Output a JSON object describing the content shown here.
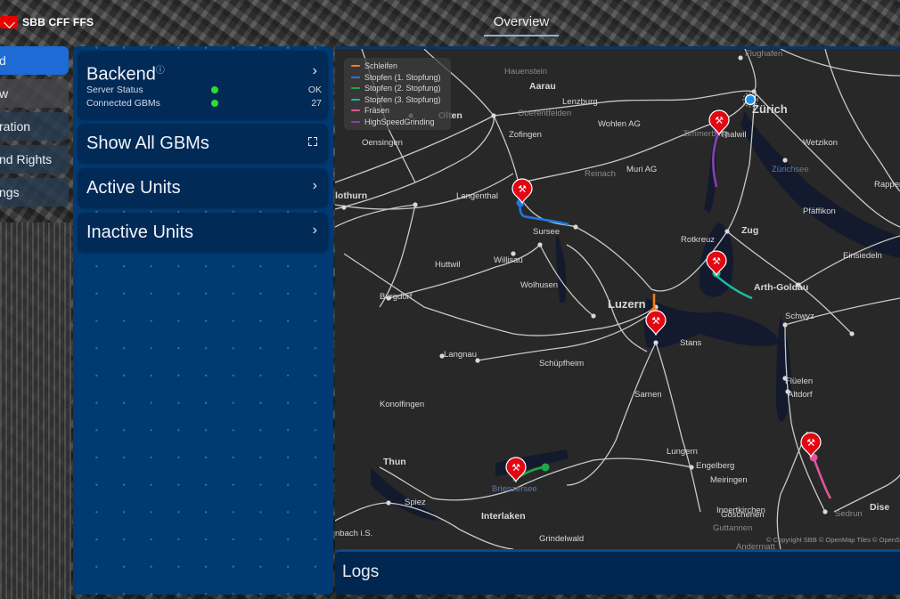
{
  "brand": {
    "name": "SBB CFF FFS",
    "logo_icon": "sbb-logo-icon",
    "logo_color": "#eb0000"
  },
  "header": {
    "active_tab": "Overview"
  },
  "nav": {
    "items": [
      {
        "label": "d",
        "active": true
      },
      {
        "label": "w",
        "active": false
      },
      {
        "label": "ration",
        "active": false
      },
      {
        "label": "nd Rights",
        "active": false
      },
      {
        "label": "ngs",
        "active": false
      }
    ]
  },
  "panel": {
    "backend": {
      "title": "Backend",
      "info_icon": "info-icon",
      "rows": [
        {
          "label": "Server Status",
          "indicator": "green",
          "value": "OK"
        },
        {
          "label": "Connected GBMs",
          "indicator": "green",
          "value": "27"
        }
      ]
    },
    "show_all": {
      "label": "Show All GBMs",
      "icon": "expand-icon"
    },
    "active_units": {
      "label": "Active Units"
    },
    "inactive_units": {
      "label": "Inactive Units"
    },
    "colors": {
      "panel_bg": "#003a73",
      "card_bg": "#012a57",
      "status_ok": "#2ddc2d"
    }
  },
  "map": {
    "legend": [
      {
        "label": "Schleifen",
        "color": "#f07d1a"
      },
      {
        "label": "Stopfen (1. Stopfung)",
        "color": "#1e78e0"
      },
      {
        "label": "Stopfen (2. Stopfung)",
        "color": "#1fa84a"
      },
      {
        "label": "Stopfen (3. Stopfung)",
        "color": "#1fb5a0"
      },
      {
        "label": "Fräsen",
        "color": "#e0559a"
      },
      {
        "label": "HighSpeedGrinding",
        "color": "#8a3fb0"
      }
    ],
    "places": [
      {
        "name": "Hauenstein",
        "style": "minor"
      },
      {
        "name": "Aarau",
        "style": "major"
      },
      {
        "name": "Olten",
        "style": "major"
      },
      {
        "name": "Oberentfelden",
        "style": "minor"
      },
      {
        "name": "Lenzburg",
        "style": "normal"
      },
      {
        "name": "Wohlen AG",
        "style": "normal"
      },
      {
        "name": "Zürich",
        "style": "city"
      },
      {
        "name": "Zimmerberg",
        "style": "minor"
      },
      {
        "name": "Thalwil",
        "style": "normal"
      },
      {
        "name": "Wetzikon",
        "style": "normal"
      },
      {
        "name": "Zürichsee",
        "style": "water"
      },
      {
        "name": "Rappersw",
        "style": "normal"
      },
      {
        "name": "Pfäffikon",
        "style": "normal"
      },
      {
        "name": "Oensingen",
        "style": "normal"
      },
      {
        "name": "Zofingen",
        "style": "normal"
      },
      {
        "name": "Reinach",
        "style": "minor"
      },
      {
        "name": "Muri AG",
        "style": "normal"
      },
      {
        "name": "lothurn",
        "style": "major"
      },
      {
        "name": "Langenthal",
        "style": "normal"
      },
      {
        "name": "Sursee",
        "style": "normal"
      },
      {
        "name": "Zug",
        "style": "major"
      },
      {
        "name": "Rotkreuz",
        "style": "normal"
      },
      {
        "name": "Einsiedeln",
        "style": "normal"
      },
      {
        "name": "Huttwil",
        "style": "normal"
      },
      {
        "name": "Willisau",
        "style": "normal"
      },
      {
        "name": "Arth-Goldau",
        "style": "major"
      },
      {
        "name": "Burgdorf",
        "style": "normal"
      },
      {
        "name": "Wolhusen",
        "style": "normal"
      },
      {
        "name": "Luzern",
        "style": "city"
      },
      {
        "name": "Schwyz",
        "style": "normal"
      },
      {
        "name": "Stans",
        "style": "normal"
      },
      {
        "name": "Langnau",
        "style": "normal"
      },
      {
        "name": "Schüpfheim",
        "style": "normal"
      },
      {
        "name": "Sarnen",
        "style": "normal"
      },
      {
        "name": "Flüelen",
        "style": "normal"
      },
      {
        "name": "Altdorf",
        "style": "normal"
      },
      {
        "name": "Konolfingen",
        "style": "normal"
      },
      {
        "name": "Engelberg",
        "style": "normal"
      },
      {
        "name": "Thun",
        "style": "major"
      },
      {
        "name": "Lungern",
        "style": "normal"
      },
      {
        "name": "Brienzersee",
        "style": "water"
      },
      {
        "name": "Meiringen",
        "style": "normal"
      },
      {
        "name": "Spiez",
        "style": "normal"
      },
      {
        "name": "Interlaken",
        "style": "major"
      },
      {
        "name": "Innertkirchen",
        "style": "normal"
      },
      {
        "name": "Göschenen",
        "style": "normal"
      },
      {
        "name": "Sedrun",
        "style": "minor"
      },
      {
        "name": "Dise",
        "style": "major"
      },
      {
        "name": "nbach i.S.",
        "style": "normal"
      },
      {
        "name": "Guttannen",
        "style": "minor"
      },
      {
        "name": "Grindelwald",
        "style": "normal"
      },
      {
        "name": "Andermatt",
        "style": "minor"
      },
      {
        "name": "Flughafen",
        "style": "minor"
      }
    ],
    "worksites": [
      {
        "name": "worksite-zimmerberg",
        "type": "HighSpeedGrinding"
      },
      {
        "name": "worksite-sursee",
        "type": "Stopfen (1. Stopfung)"
      },
      {
        "name": "worksite-zug",
        "type": "Stopfen (3. Stopfung)"
      },
      {
        "name": "worksite-luzern",
        "type": "Schleifen"
      },
      {
        "name": "worksite-brienz",
        "type": "Stopfen (2. Stopfung)"
      },
      {
        "name": "worksite-uri",
        "type": "Fräsen"
      }
    ],
    "copyright": "© Copyright SBB  © OpenMap Tiles  © OpenS"
  },
  "logs": {
    "title": "Logs"
  }
}
